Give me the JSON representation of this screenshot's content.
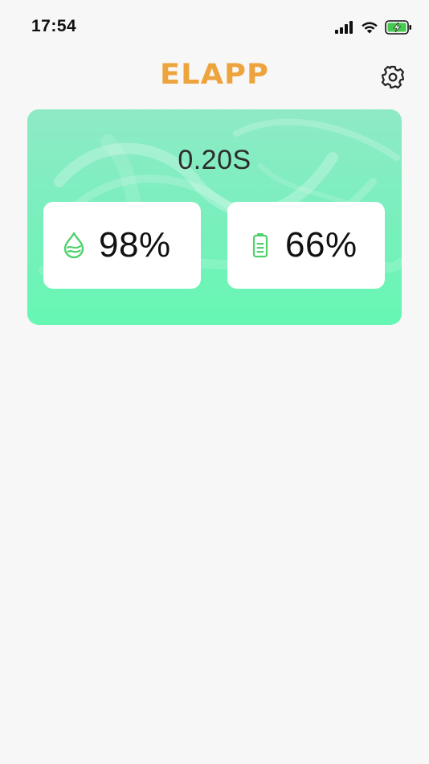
{
  "status_bar": {
    "time": "17:54",
    "icons": [
      "signal-icon",
      "wifi-icon",
      "battery-charging-icon"
    ]
  },
  "header": {
    "logo_text": "ELAPP",
    "settings_icon": "gear-icon"
  },
  "card": {
    "timer": "0.20S",
    "metrics": [
      {
        "icon": "water-drop-icon",
        "value": "98%"
      },
      {
        "icon": "battery-icon",
        "value": "66%"
      }
    ]
  },
  "colors": {
    "brand": "#eea43c",
    "card_gradient_top": "#8feac5",
    "card_gradient_bottom": "#66f7b3",
    "icon_green": "#4fd26e",
    "background": "#f7f7f7"
  }
}
